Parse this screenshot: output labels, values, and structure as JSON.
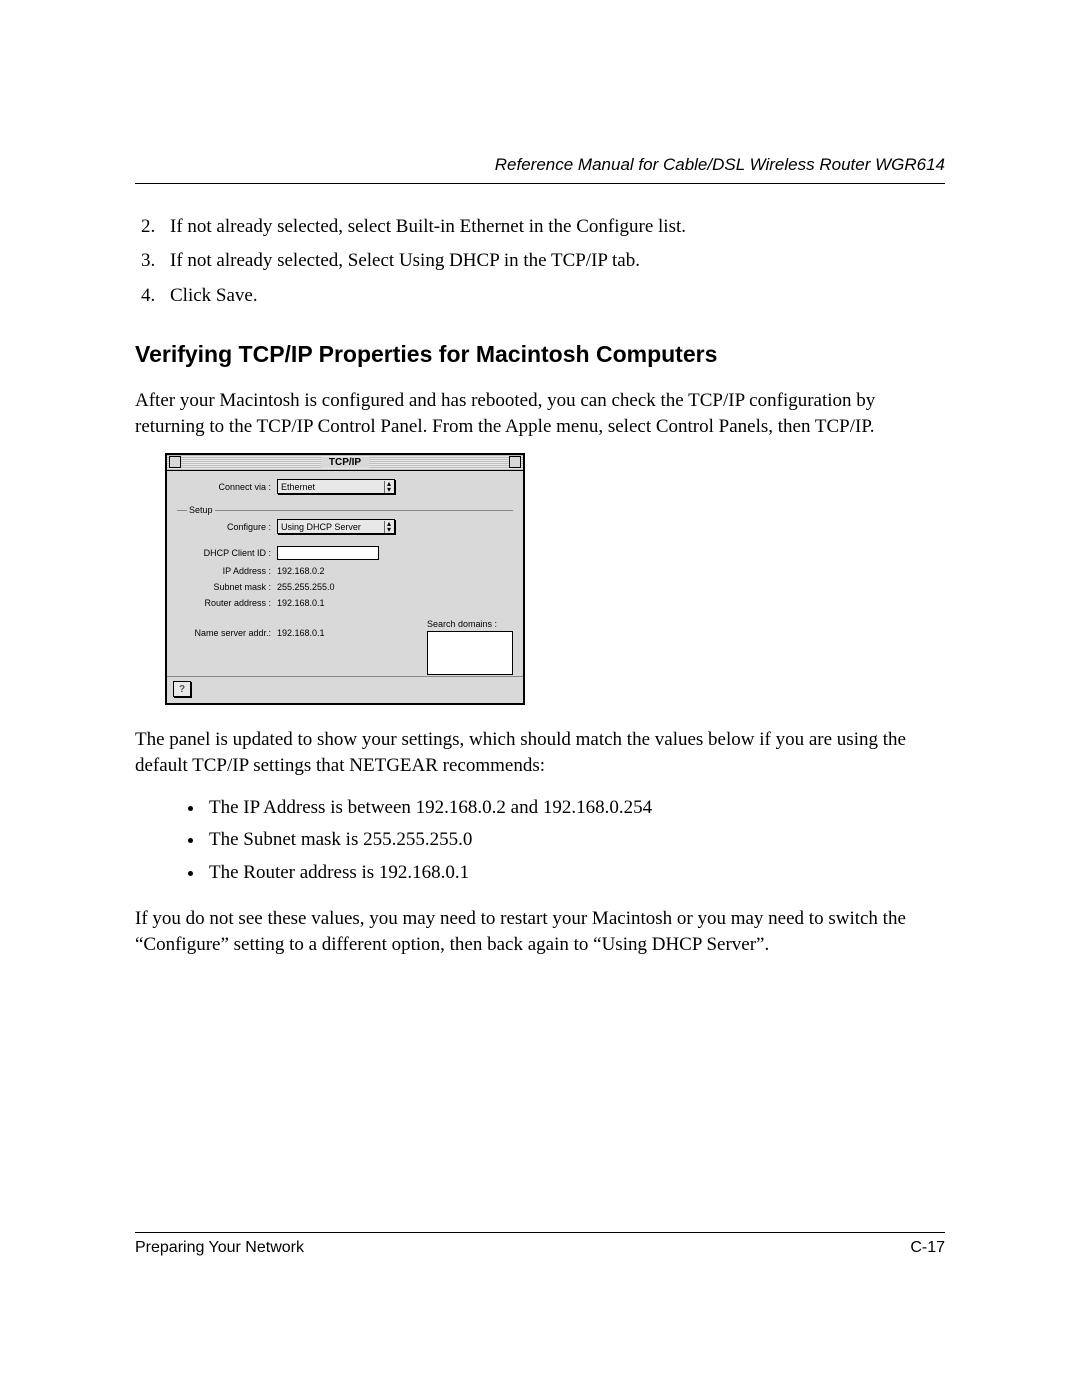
{
  "header": {
    "running_title": "Reference Manual for Cable/DSL Wireless Router WGR614"
  },
  "steps": {
    "start": 2,
    "items": [
      "If not already selected, select Built-in Ethernet in the Configure list.",
      "If not already selected, Select Using DHCP in the TCP/IP tab.",
      "Click Save."
    ]
  },
  "section": {
    "heading": "Verifying TCP/IP Properties for Macintosh Computers",
    "para1": "After your Macintosh is configured and has rebooted, you can check the TCP/IP configuration by returning to the TCP/IP Control Panel. From the Apple menu, select Control Panels, then TCP/IP.",
    "para2": "The panel is updated to show your settings, which should match the values below if you are using the default TCP/IP settings that NETGEAR recommends:",
    "bullets": [
      "The IP Address is between 192.168.0.2 and 192.168.0.254",
      "The Subnet mask is 255.255.255.0",
      "The Router address is 192.168.0.1"
    ],
    "para3": "If you do not see these values, you may need to restart your Macintosh or you may need to switch the “Configure” setting to a different option, then back again to “Using DHCP Server”."
  },
  "tcpip_panel": {
    "title": "TCP/IP",
    "connect_via_label": "Connect via :",
    "connect_via_value": "Ethernet",
    "setup_legend": "Setup",
    "configure_label": "Configure :",
    "configure_value": "Using DHCP Server",
    "dhcp_client_label": "DHCP Client ID :",
    "dhcp_client_value": "",
    "ip_label": "IP Address :",
    "ip_value": "192.168.0.2",
    "subnet_label": "Subnet mask :",
    "subnet_value": "255.255.255.0",
    "router_label": "Router address :",
    "router_value": "192.168.0.1",
    "nameserver_label": "Name server addr.:",
    "nameserver_value": "192.168.0.1",
    "search_domains_label": "Search domains :",
    "help_glyph": "?"
  },
  "footer": {
    "section_name": "Preparing Your Network",
    "page_number": "C-17"
  }
}
